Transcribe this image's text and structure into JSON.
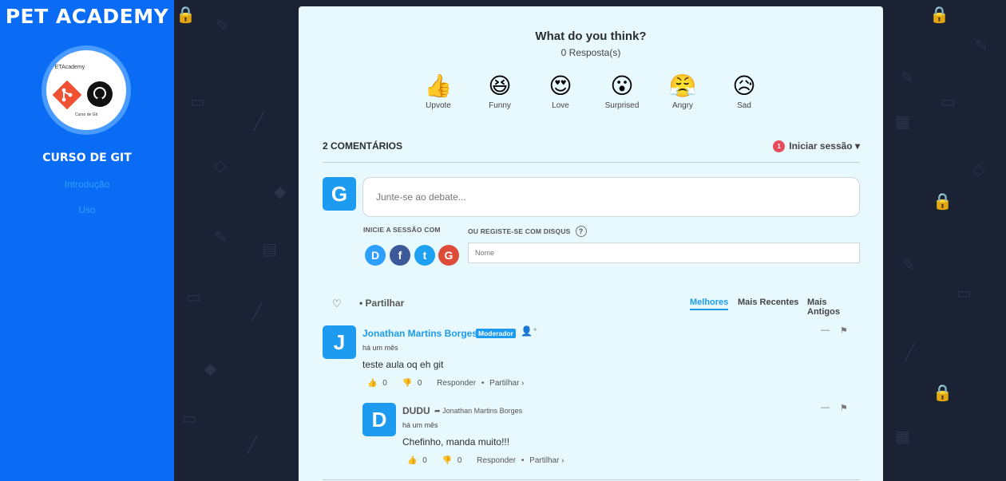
{
  "sidebar": {
    "brand": "PET ACADEMY",
    "logo_caption": "Curso de Git",
    "logo_small": "PETAcademy",
    "course_title": "CURSO DE GIT",
    "nav": [
      "Introdução",
      "Uso"
    ]
  },
  "reactions_header": {
    "title": "What do you think?",
    "count": "0 Resposta(s)"
  },
  "reactions": [
    {
      "label": "Upvote",
      "icon": "thumbs-up-icon",
      "glyph": "👍"
    },
    {
      "label": "Funny",
      "icon": "funny-face-icon",
      "glyph": "😆"
    },
    {
      "label": "Love",
      "icon": "heart-eyes-icon",
      "glyph": "😍"
    },
    {
      "label": "Surprised",
      "icon": "surprised-face-icon",
      "glyph": "😮"
    },
    {
      "label": "Angry",
      "icon": "angry-face-icon",
      "glyph": "😤"
    },
    {
      "label": "Sad",
      "icon": "sad-face-icon",
      "glyph": "😥"
    }
  ],
  "comments_header": {
    "count_label": "2 COMENTÁRIOS",
    "notification_count": "1",
    "login_label": "Iniciar sessão"
  },
  "composer": {
    "avatar_letter": "G",
    "placeholder": "Junte-se ao debate...",
    "login_with": "INICIE A SESSÃO COM",
    "register": "OU REGISTE-SE COM DISQUS",
    "name_placeholder": "Nome",
    "socials": [
      {
        "name": "disqus",
        "letter": "D",
        "color": "#2e9fff"
      },
      {
        "name": "facebook",
        "letter": "f",
        "color": "#3b5998"
      },
      {
        "name": "twitter",
        "letter": "t",
        "color": "#1da1f2"
      },
      {
        "name": "google",
        "letter": "G",
        "color": "#dd4b39"
      }
    ]
  },
  "toolbar": {
    "share": "Partilhar",
    "sort": [
      "Melhores",
      "Mais Recentes",
      "Mais Antigos"
    ]
  },
  "comments": [
    {
      "avatar": "J",
      "author": "Jonathan Martins Borges",
      "badge": "Moderador",
      "time": "há um mês",
      "text": "teste aula oq eh git",
      "upvotes": "0",
      "downvotes": "0",
      "reply": "Responder",
      "share": "Partilhar ›"
    },
    {
      "avatar": "D",
      "author": "DUDU",
      "reply_to": "Jonathan Martins Borges",
      "time": "há um mês",
      "text": "Chefinho, manda muito!!!",
      "upvotes": "0",
      "downvotes": "0",
      "reply": "Responder",
      "share": "Partilhar ›"
    }
  ],
  "colors": {
    "sidebar": "#0a6cf5",
    "accent": "#1d9bf0",
    "card": "#e8f9fd",
    "background": "#1a2233"
  }
}
